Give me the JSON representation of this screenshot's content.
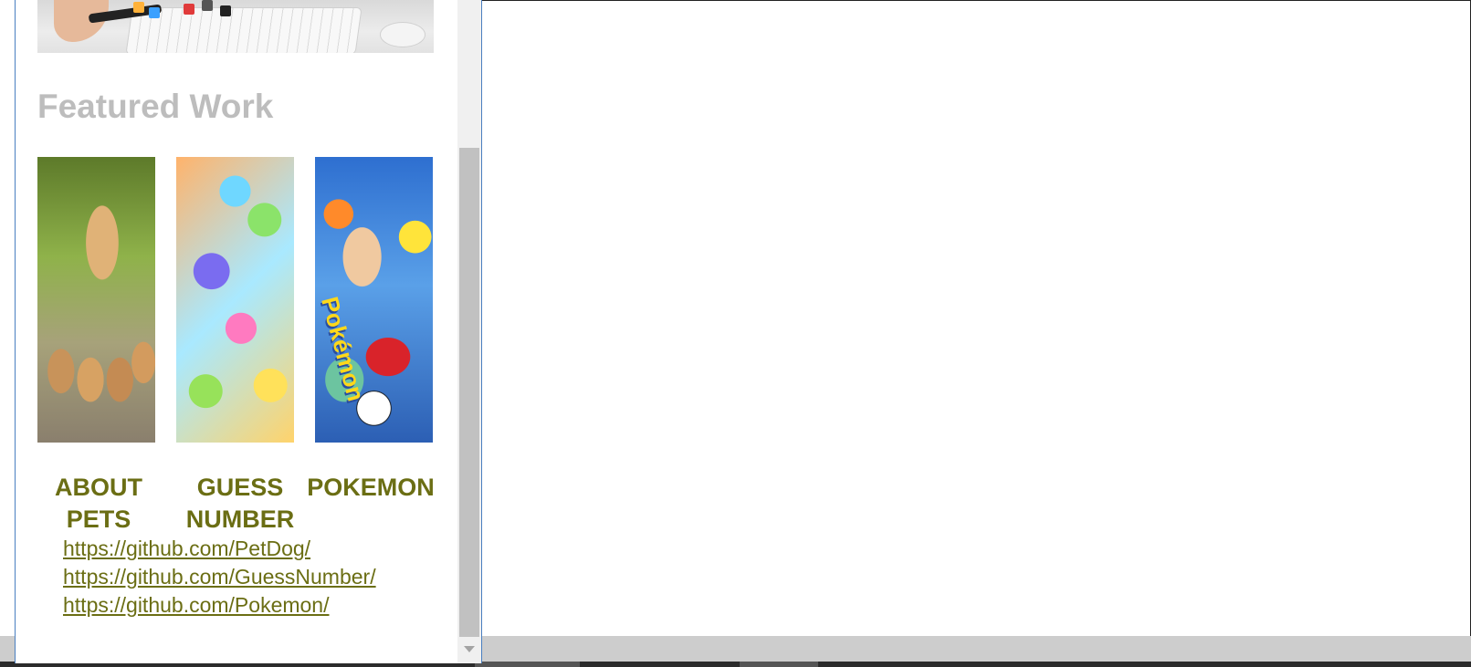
{
  "featured": {
    "title": "Featured Work",
    "projects": [
      {
        "title": "ABOUT PETS",
        "image_alt": "golden retriever dogs"
      },
      {
        "title": "GUESS NUMBER",
        "image_alt": "colorful numbers"
      },
      {
        "title": "POKEMON",
        "image_alt": "pokemon characters"
      }
    ],
    "links": [
      "https://github.com/PetDog/",
      "https://github.com/GuessNumber/",
      "https://github.com/Pokemon/"
    ]
  },
  "hero": {
    "image_alt": "hands with phone and keyboard"
  },
  "colors": {
    "accent_olive": "#6b6e14",
    "title_gray": "#bdbdbd",
    "window_border": "#4a7fc0",
    "taskbar": "#cdcdcd"
  },
  "icons": {
    "scroll_down": "chevron-down-icon"
  }
}
